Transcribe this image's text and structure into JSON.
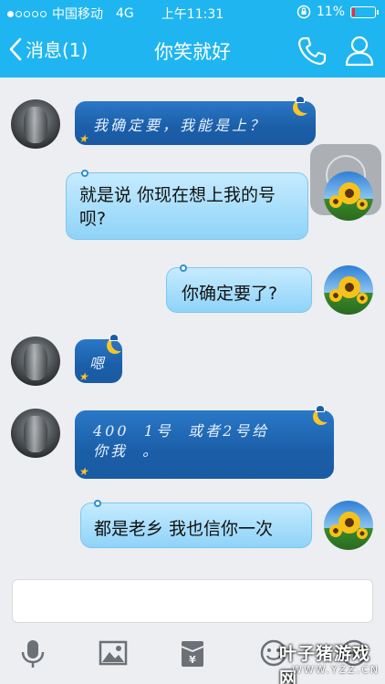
{
  "status_bar": {
    "carrier": "中国移动",
    "network": "4G",
    "time": "上午11:31",
    "battery": "11%"
  },
  "nav": {
    "back_label": "消息(1)",
    "title": "你笑就好"
  },
  "messages": [
    {
      "side": "left",
      "style": "dark",
      "text": "我确定要，我能是上？"
    },
    {
      "side": "right",
      "style": "light",
      "text": "就是说 你现在想上我的号\n呗?"
    },
    {
      "side": "right",
      "style": "light",
      "text": "你确定要了?"
    },
    {
      "side": "left",
      "style": "dark",
      "text": "嗯"
    },
    {
      "side": "left",
      "style": "dark",
      "text": "400  1号  或者2号给\n你我  。"
    },
    {
      "side": "right",
      "style": "light",
      "text": "都是老乡 我也信你一次"
    }
  ],
  "input": {
    "placeholder": ""
  },
  "toolbar": {
    "icons": [
      "microphone-icon",
      "image-icon",
      "red-packet-icon",
      "emoji-icon",
      "plus-icon"
    ]
  },
  "watermark": {
    "main": "叶子猪游戏网",
    "sub": "WWW.YZZ.CN"
  },
  "colors": {
    "header": "#1fb5f0",
    "bubble_dark": "#1b5ea8",
    "bubble_light": "#9fd9f9",
    "background": "#eceef2"
  }
}
